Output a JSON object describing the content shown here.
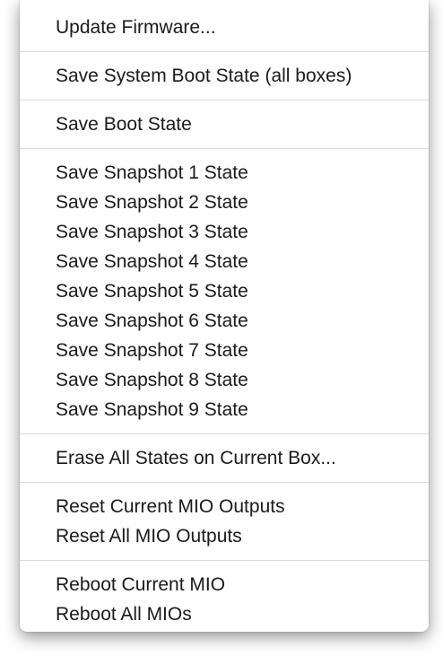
{
  "menu": {
    "groups": [
      {
        "items": [
          "Update Firmware..."
        ]
      },
      {
        "items": [
          "Save System Boot State (all boxes)"
        ]
      },
      {
        "items": [
          "Save Boot State"
        ]
      },
      {
        "items": [
          "Save Snapshot 1 State",
          "Save Snapshot 2 State",
          "Save Snapshot 3 State",
          "Save Snapshot 4 State",
          "Save Snapshot 5 State",
          "Save Snapshot 6 State",
          "Save Snapshot 7 State",
          "Save Snapshot 8 State",
          "Save Snapshot 9 State"
        ]
      },
      {
        "items": [
          "Erase All States on Current Box..."
        ]
      },
      {
        "items": [
          "Reset Current MIO Outputs",
          "Reset All MIO Outputs"
        ]
      },
      {
        "items": [
          "Reboot Current MIO",
          "Reboot All MIOs"
        ]
      }
    ]
  }
}
